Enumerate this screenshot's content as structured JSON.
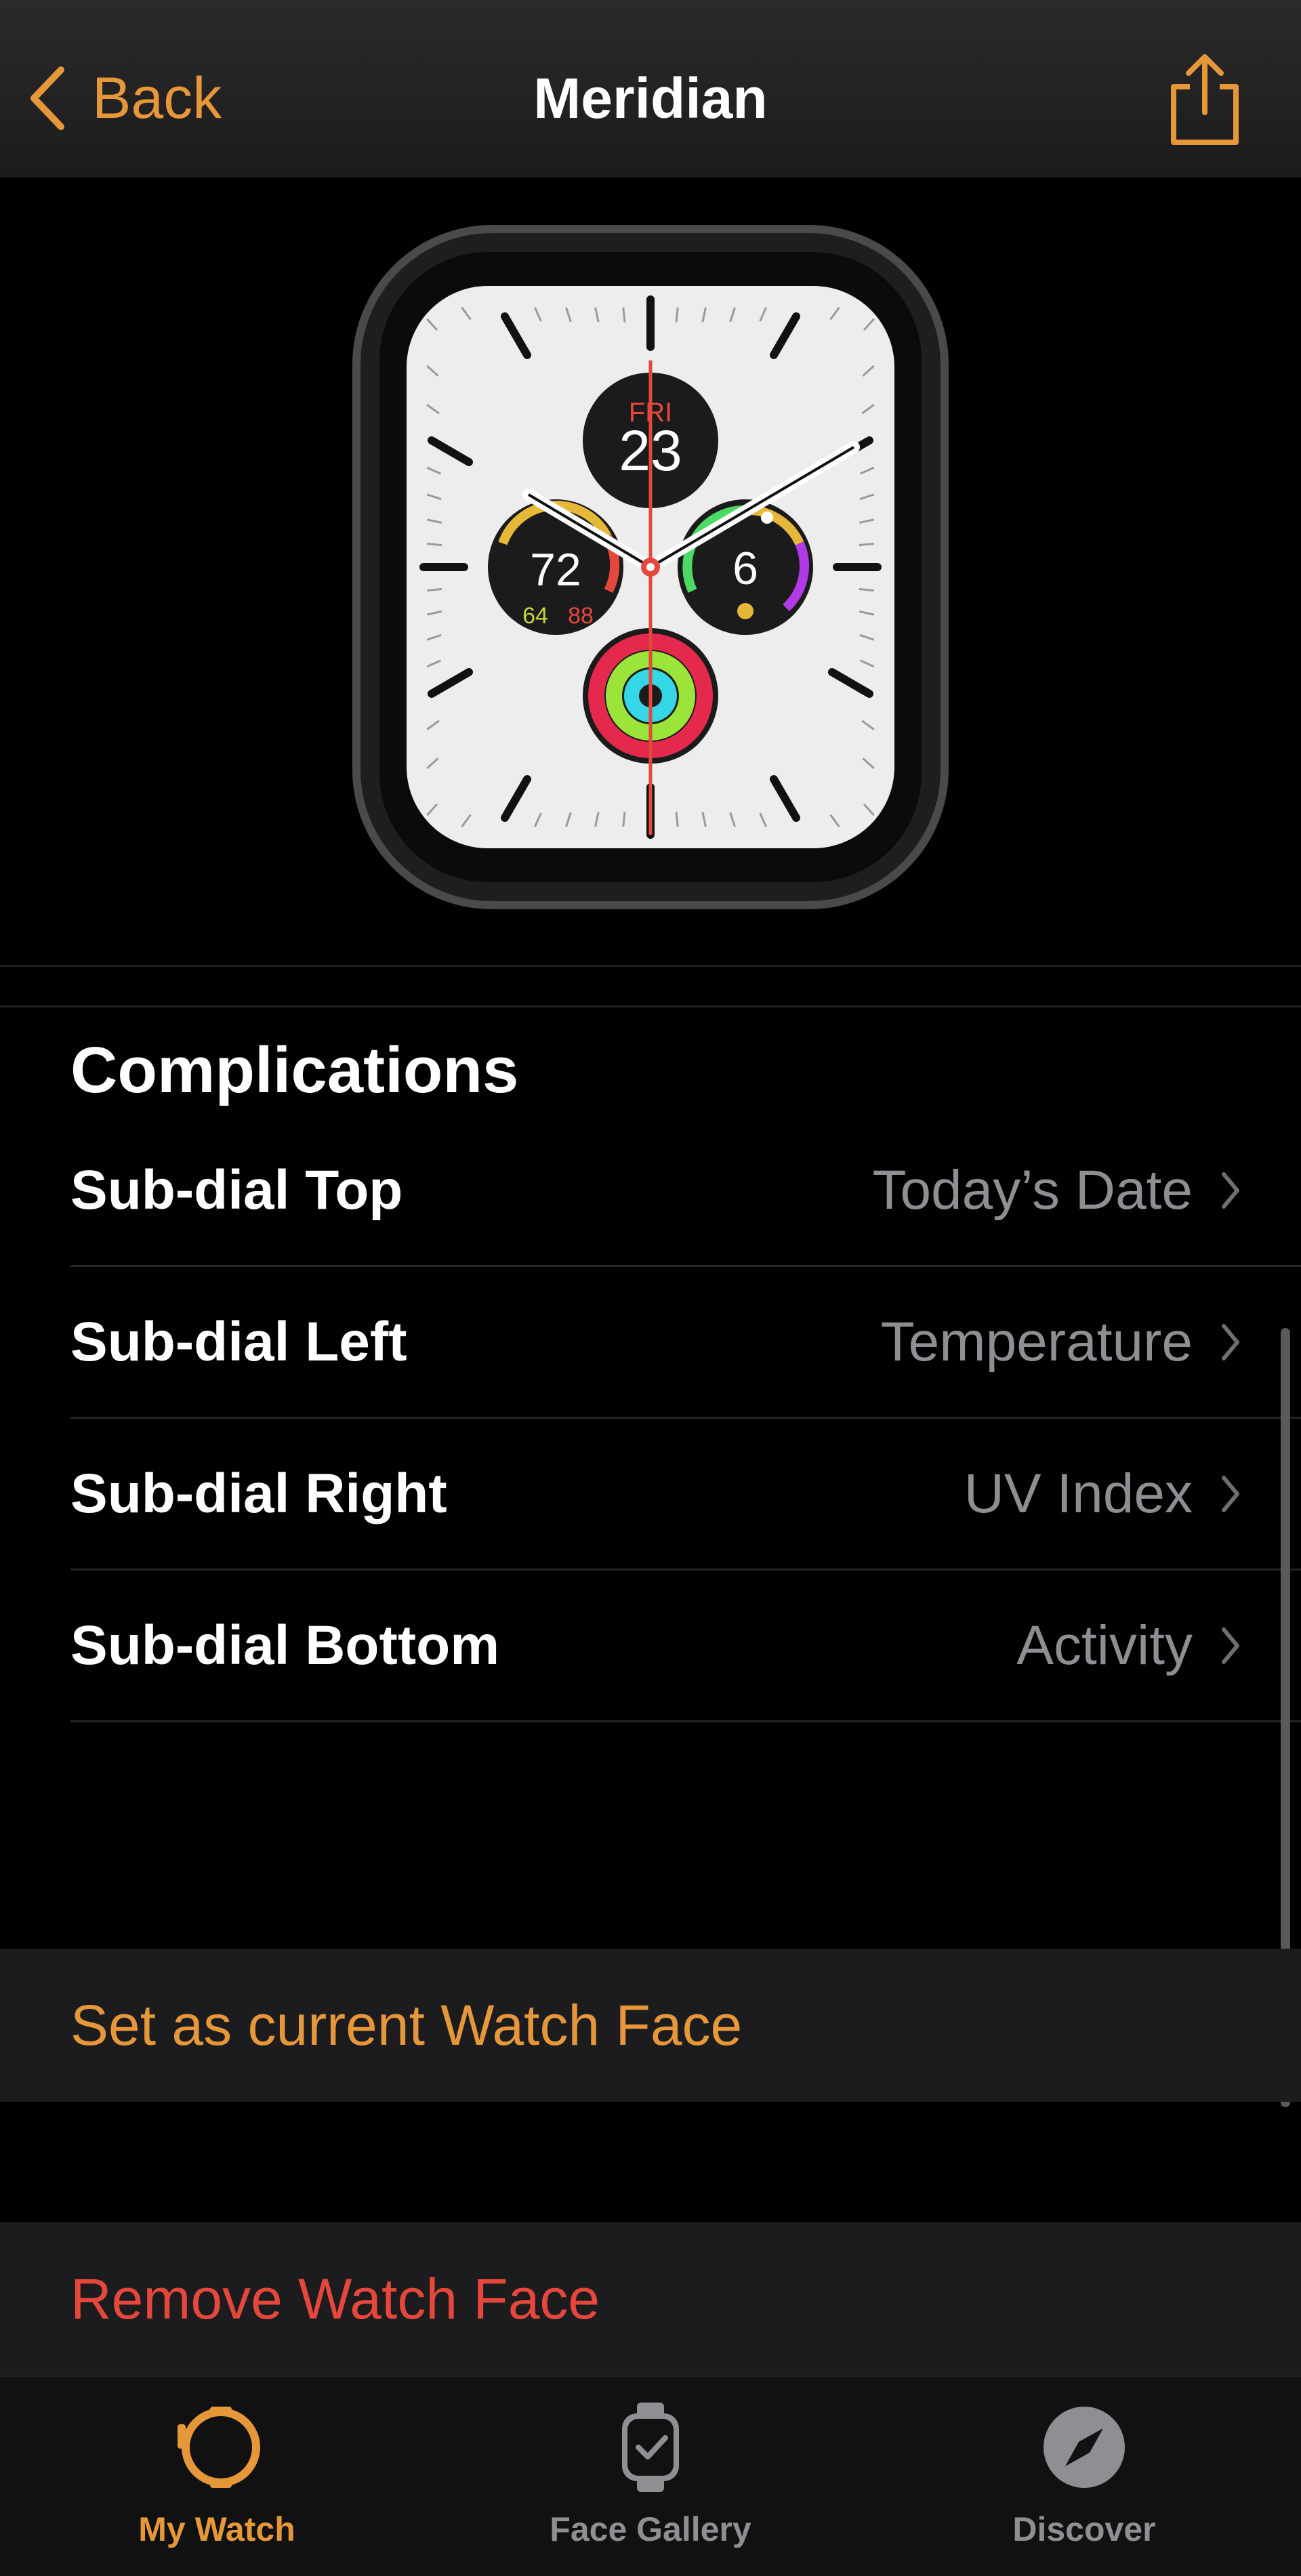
{
  "nav": {
    "back_label": "Back",
    "title": "Meridian",
    "share_icon": "share-icon"
  },
  "watch_face": {
    "day": "FRI",
    "date": "23",
    "temperature": "72",
    "temp_low": "64",
    "temp_high": "88",
    "uv_index": "6"
  },
  "complications": {
    "title": "Complications",
    "items": [
      {
        "label": "Sub-dial Top",
        "value": "Today’s Date"
      },
      {
        "label": "Sub-dial Left",
        "value": "Temperature"
      },
      {
        "label": "Sub-dial Right",
        "value": "UV Index"
      },
      {
        "label": "Sub-dial Bottom",
        "value": "Activity"
      }
    ]
  },
  "actions": {
    "set_current": "Set as current Watch Face",
    "remove": "Remove Watch Face"
  },
  "tabs": [
    {
      "label": "My Watch",
      "icon": "watch-icon",
      "active": true
    },
    {
      "label": "Face Gallery",
      "icon": "watch-face-icon",
      "active": false
    },
    {
      "label": "Discover",
      "icon": "compass-icon",
      "active": false
    }
  ],
  "colors": {
    "accent": "#e5973a",
    "destructive": "#e5473c",
    "secondary_text": "#8e8e93"
  }
}
